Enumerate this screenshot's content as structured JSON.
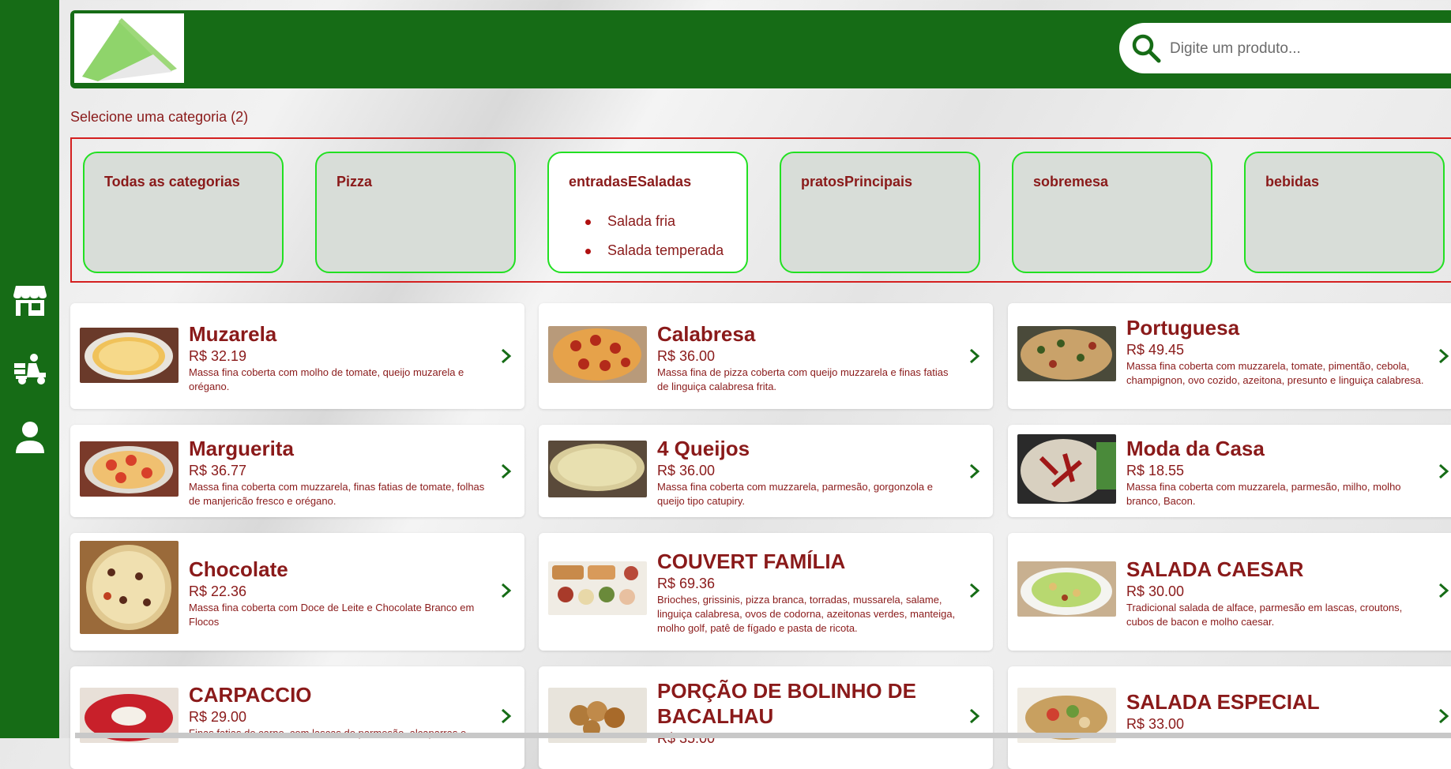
{
  "search": {
    "placeholder": "Digite um produto..."
  },
  "categories_title": "Selecione uma categoria (2)",
  "categories": [
    {
      "name": "Todas as categorias",
      "active": false,
      "items": []
    },
    {
      "name": "Pizza",
      "active": false,
      "items": []
    },
    {
      "name": "entradasESaladas",
      "active": true,
      "items": [
        "Salada fria",
        "Salada temperada"
      ]
    },
    {
      "name": "pratosPrincipais",
      "active": false,
      "items": []
    },
    {
      "name": "sobremesa",
      "active": false,
      "items": []
    },
    {
      "name": "bebidas",
      "active": false,
      "items": []
    }
  ],
  "products": [
    {
      "name": "Muzarela",
      "price": "R$ 32.19",
      "desc": "Massa fina coberta com molho de tomate, queijo muzarela e orégano."
    },
    {
      "name": "Calabresa",
      "price": "R$ 36.00",
      "desc": "Massa fina de pizza coberta com queijo muzzarela e finas fatias de linguiça calabresa frita."
    },
    {
      "name": "Portuguesa",
      "price": "R$ 49.45",
      "desc": "Massa fina coberta com muzzarela, tomate, pimentão, cebola, champignon, ovo cozido, azeitona, presunto e linguiça calabresa."
    },
    {
      "name": "Marguerita",
      "price": "R$ 36.77",
      "desc": "Massa fina coberta com muzzarela, finas fatias de tomate, folhas de manjericão fresco e orégano."
    },
    {
      "name": "4 Queijos",
      "price": "R$ 36.00",
      "desc": "Massa fina coberta com muzzarela, parmesão, gorgonzola e queijo tipo catupiry."
    },
    {
      "name": "Moda da Casa",
      "price": "R$ 18.55",
      "desc": "Massa fina coberta com muzzarela, parmesão, milho, molho branco, Bacon."
    },
    {
      "name": "Chocolate",
      "price": "R$ 22.36",
      "desc": "Massa fina coberta com Doce de Leite e Chocolate Branco em Flocos"
    },
    {
      "name": "COUVERT FAMÍLIA",
      "price": "R$ 69.36",
      "desc": "Brioches, grissinis, pizza branca, torradas, mussarela, salame, linguiça calabresa, ovos de codorna, azeitonas verdes, manteiga, molho golf, patê de fígado e pasta de ricota."
    },
    {
      "name": "SALADA CAESAR",
      "price": "R$ 30.00",
      "desc": "Tradicional salada de alface, parmesão em lascas, croutons, cubos de bacon e molho caesar."
    },
    {
      "name": "CARPACCIO",
      "price": "R$ 29.00",
      "desc": "Finas fatias de carne, com lascas de parmesão, alcaparras e..."
    },
    {
      "name": "PORÇÃO DE BOLINHO DE BACALHAU",
      "price": "R$ 35.00",
      "desc": ""
    },
    {
      "name": "SALADA ESPECIAL",
      "price": "R$ 33.00",
      "desc": ""
    }
  ],
  "colors": {
    "brand_green": "#166c16",
    "accent_red": "#8a1a1a",
    "category_border": "#22e022"
  },
  "icons": {
    "sidebar": [
      "store-icon",
      "delivery-icon",
      "user-icon"
    ],
    "search": "search-icon",
    "chevron": "chevron-right-icon"
  }
}
